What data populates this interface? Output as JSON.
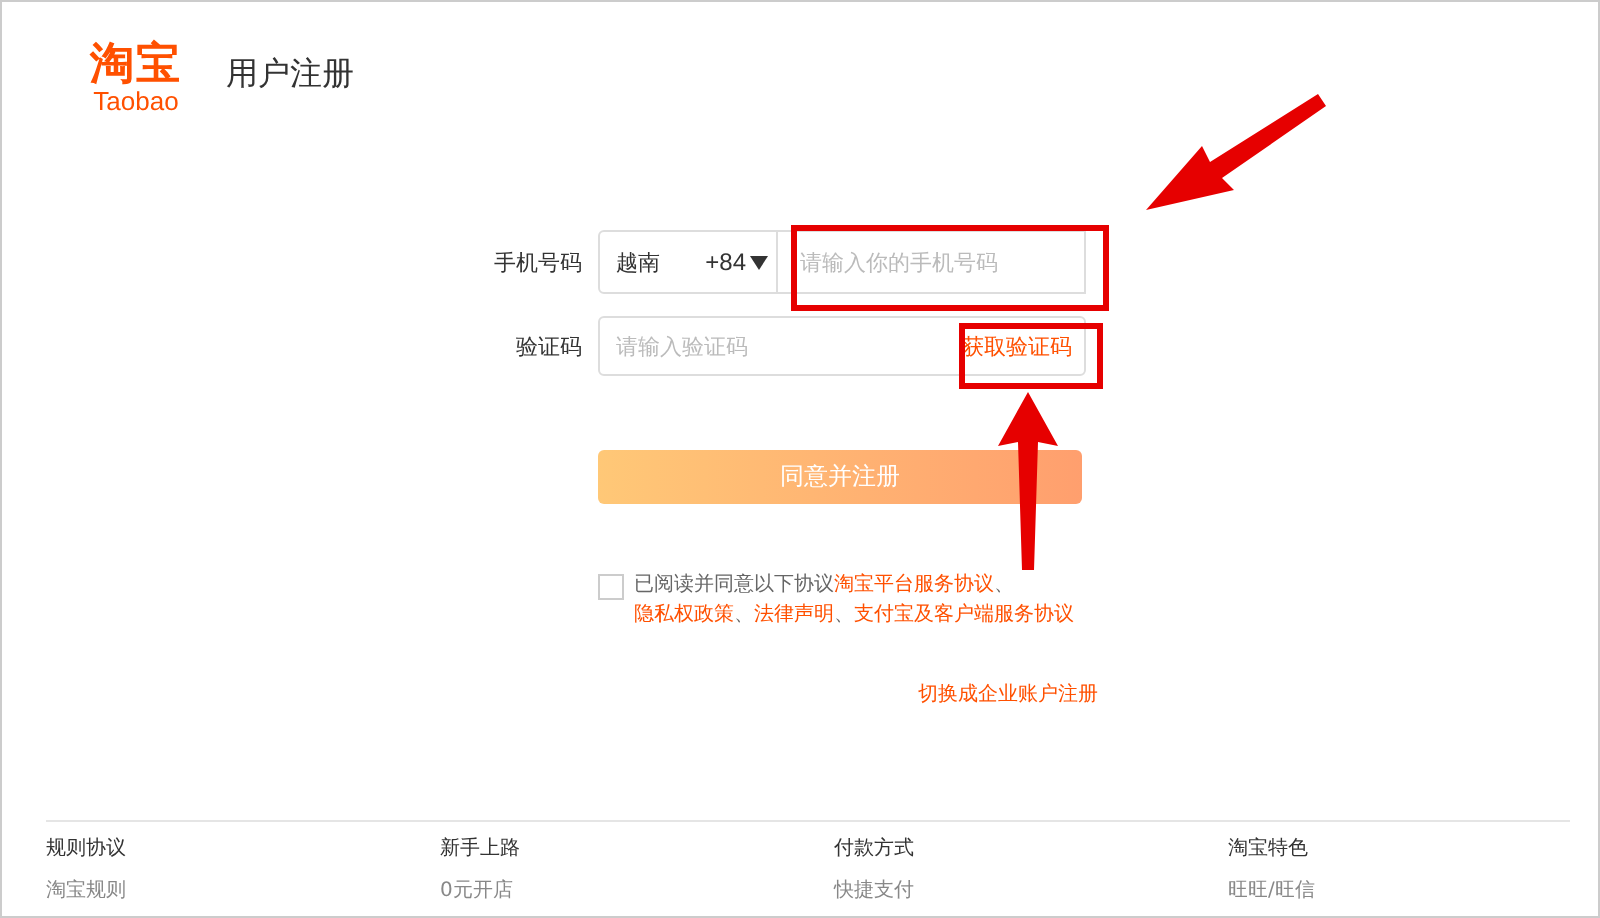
{
  "header": {
    "logo_mark": "淘宝",
    "logo_text": "Taobao",
    "title": "用户注册"
  },
  "form": {
    "phone_label": "手机号码",
    "country": "越南",
    "country_code": "+84",
    "phone_placeholder": "请输入你的手机号码",
    "code_label": "验证码",
    "code_placeholder": "请输入验证码",
    "get_code": "获取验证码",
    "submit": "同意并注册",
    "agreement": {
      "checked": false,
      "prefix": "已阅读并同意以下协议",
      "links": [
        "淘宝平台服务协议",
        "隐私权政策",
        "法律声明",
        "支付宝及客户端服务协议"
      ],
      "separator": "、"
    },
    "switch_link": "切换成企业账户注册"
  },
  "footer": {
    "columns": [
      {
        "heading": "规则协议",
        "item": "淘宝规则"
      },
      {
        "heading": "新手上路",
        "item": "0元开店"
      },
      {
        "heading": "付款方式",
        "item": "快捷支付"
      },
      {
        "heading": "淘宝特色",
        "item": "旺旺/旺信"
      }
    ]
  }
}
